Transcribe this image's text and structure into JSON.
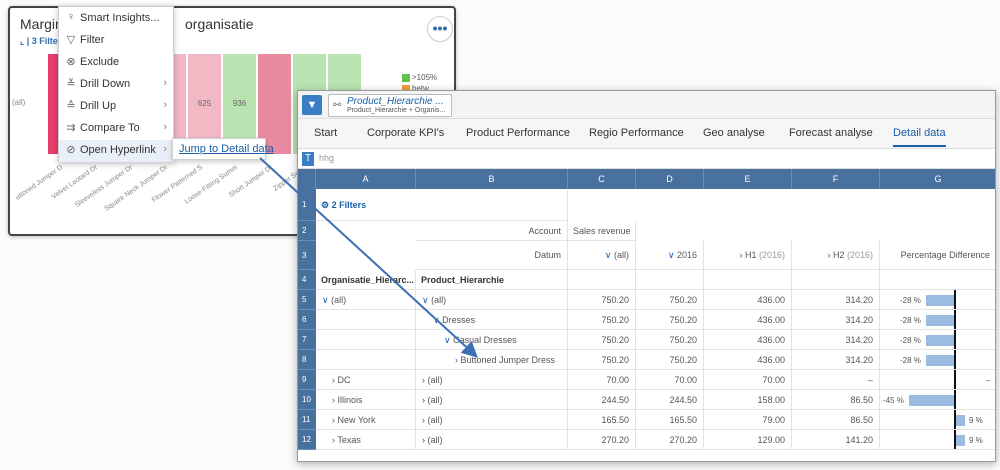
{
  "chart_card": {
    "title_left": "Margin p",
    "title_right": "organisatie",
    "filters": "3 Filter",
    "more_label": "•••",
    "row_label": "(all)",
    "cells": [
      {
        "value": "",
        "color": "#e83e6c"
      },
      {
        "value": "",
        "color": "#f2b8c4"
      },
      {
        "value": "",
        "color": "#f2b8c4"
      },
      {
        "value": "0",
        "color": "#f2b8c4"
      },
      {
        "value": "625",
        "color": "#f2b8c4"
      },
      {
        "value": "936",
        "color": "#b9e3b0"
      },
      {
        "value": "",
        "color": "#e88aa0"
      },
      {
        "value": "",
        "color": "#b9e3b0"
      },
      {
        "value": "",
        "color": "#b9e3b0"
      }
    ],
    "legend": [
      {
        "label": ">105%",
        "color": "#62c04f"
      },
      {
        "label": "betw...",
        "color": "#f29b3a"
      }
    ],
    "x_labels": [
      "uttoned Jumper D",
      "Velvet Leotard Dr",
      "Sleeveless Jumper Dr",
      "Square Neck Jumper Dr",
      "Flower Patterned S",
      "Loose-Fitting Summ",
      "Short Jumper Dr",
      "Zipper Seam"
    ]
  },
  "context_menu": {
    "items": [
      {
        "label": "Smart Insights...",
        "icon": "lightbulb-icon",
        "glyph": "♀",
        "arrow": ""
      },
      {
        "label": "Filter",
        "icon": "filter-icon",
        "glyph": "▽",
        "arrow": ""
      },
      {
        "label": "Exclude",
        "icon": "exclude-icon",
        "glyph": "⊗",
        "arrow": ""
      },
      {
        "label": "Drill Down",
        "icon": "drill-down-icon",
        "glyph": "≚",
        "arrow": "›"
      },
      {
        "label": "Drill Up",
        "icon": "drill-up-icon",
        "glyph": "≙",
        "arrow": "›"
      },
      {
        "label": "Compare To",
        "icon": "compare-icon",
        "glyph": "⇉",
        "arrow": "›"
      },
      {
        "label": "Open Hyperlink",
        "icon": "link-icon",
        "glyph": "⊘",
        "arrow": "›"
      }
    ],
    "submenu_label": "Jump to Detail data"
  },
  "sheet": {
    "hierarchy_title": "Product_Hierarchie ...",
    "hierarchy_sub": "Product_Hierarchie + Organis...",
    "tabs": [
      "Start",
      "Corporate KPI's",
      "Product Performance",
      "Regio Performance",
      "Geo analyse",
      "Forecast analyse",
      "Detail data"
    ],
    "active_tab": "Detail data",
    "formula_text": "hhg",
    "columns": [
      "A",
      "B",
      "C",
      "D",
      "E",
      "F",
      "G"
    ],
    "filters_label": "2 Filters",
    "row2": {
      "label": "Account",
      "value": "Sales revenue"
    },
    "row3": {
      "label": "Datum",
      "c": "(all)",
      "d": "2016",
      "e_main": "H1",
      "e_sub": "(2016)",
      "f_main": "H2",
      "f_sub": "(2016)",
      "g": "Percentage Difference"
    },
    "row4": {
      "a": "Organisatie_Hierarc...",
      "b": "Product_Hierarchie"
    },
    "data_rows": [
      {
        "n": "5",
        "a": "(all)",
        "a_chev": "∨",
        "b": "(all)",
        "b_chev": "∨",
        "b_indent": 0,
        "c": "750.20",
        "d": "750.20",
        "e": "436.00",
        "f": "314.20",
        "pct": -28,
        "pct_label": "-28 %"
      },
      {
        "n": "6",
        "a": "",
        "a_chev": "",
        "b": "Dresses",
        "b_chev": "∨",
        "b_indent": 1,
        "c": "750.20",
        "d": "750.20",
        "e": "436.00",
        "f": "314.20",
        "pct": -28,
        "pct_label": "-28 %"
      },
      {
        "n": "7",
        "a": "",
        "a_chev": "",
        "b": "Casual Dresses",
        "b_chev": "∨",
        "b_indent": 2,
        "c": "750.20",
        "d": "750.20",
        "e": "436.00",
        "f": "314.20",
        "pct": -28,
        "pct_label": "-28 %"
      },
      {
        "n": "8",
        "a": "",
        "a_chev": "",
        "b": "Buttoned Jumper Dress",
        "b_chev": "›",
        "b_indent": 3,
        "c": "750.20",
        "d": "750.20",
        "e": "436.00",
        "f": "314.20",
        "pct": -28,
        "pct_label": "-28 %"
      },
      {
        "n": "9",
        "a": "DC",
        "a_chev": "›",
        "b": "(all)",
        "b_chev": "›",
        "b_indent": 0,
        "c": "70.00",
        "d": "70.00",
        "e": "70.00",
        "f": "–",
        "pct": null,
        "pct_label": "–"
      },
      {
        "n": "10",
        "a": "Illinois",
        "a_chev": "›",
        "b": "(all)",
        "b_chev": "›",
        "b_indent": 0,
        "c": "244.50",
        "d": "244.50",
        "e": "158.00",
        "f": "86.50",
        "pct": -45,
        "pct_label": "-45 %"
      },
      {
        "n": "11",
        "a": "New York",
        "a_chev": "›",
        "b": "(all)",
        "b_chev": "›",
        "b_indent": 0,
        "c": "165.50",
        "d": "165.50",
        "e": "79.00",
        "f": "86.50",
        "pct": 9,
        "pct_label": "9 %"
      },
      {
        "n": "12",
        "a": "Texas",
        "a_chev": "›",
        "b": "(all)",
        "b_chev": "›",
        "b_indent": 0,
        "c": "270.20",
        "d": "270.20",
        "e": "129.00",
        "f": "141.20",
        "pct": 9,
        "pct_label": "9 %"
      }
    ]
  }
}
